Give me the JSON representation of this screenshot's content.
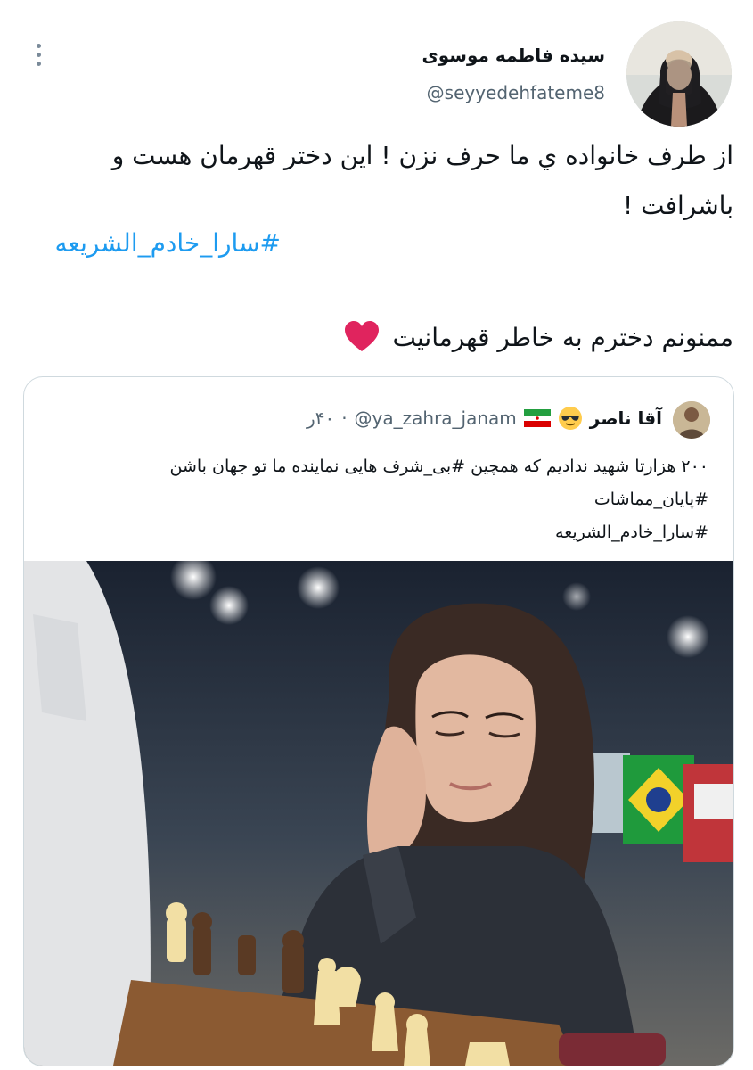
{
  "tweet": {
    "display_name": "سیده فاطمه موسوی",
    "handle": "@seyyedehfateme8",
    "text": "از طرف خانواده ي ما حرف نزن ! این دختر قهرمان هست و باشرافت !",
    "hashtag": "#سارا_خادم_الشریعه",
    "thanks": "ممنونم دخترم به خاطر قهرمانیت",
    "heart_icon": "heart-icon",
    "more_icon": "more-vertical-icon"
  },
  "quoted": {
    "display_name": "آقا ناصر",
    "emoji": "sunglasses-emoji-icon",
    "flag": "iran-flag-icon",
    "handle": "@ya_zahra_janam",
    "separator": "·",
    "time": "۴۰ر",
    "line1": "۲۰۰ هزارتا شهید ندادیم که همچین #بی_شرف هایی نماینده ما تو جهان باشن",
    "line2": "#پایان_مماشات",
    "line3": "#سارا_خادم_الشریعه"
  },
  "colors": {
    "link": "#1d9bf0",
    "secondary": "#536471",
    "border": "#cfd9de",
    "heart": "#e0245e"
  }
}
